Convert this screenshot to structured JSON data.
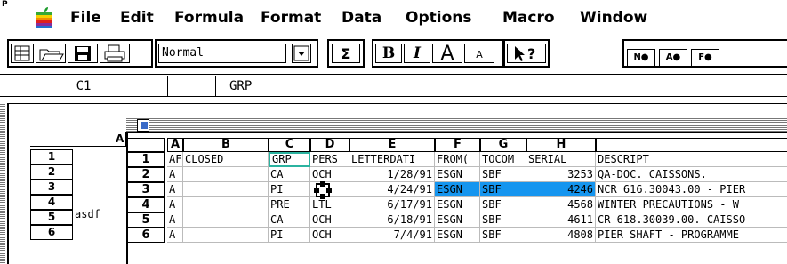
{
  "menubar": {
    "corner_mark": "P",
    "items": [
      "File",
      "Edit",
      "Formula",
      "Format",
      "Data",
      "Options",
      "Macro",
      "Window"
    ]
  },
  "toolbar": {
    "style_value": "Normal",
    "sum_label": "Σ",
    "bold_label": "B",
    "italic_label": "I",
    "grow_label": "A",
    "shrink_label": "A",
    "format_buttons": [
      "N●",
      "A●",
      "F●"
    ]
  },
  "formula_bar": {
    "cell_ref": "C1",
    "value": "GRP"
  },
  "back_sheet": {
    "col_header": "A",
    "row_numbers": [
      "1",
      "2",
      "3",
      "4",
      "5",
      "6"
    ],
    "cell_value": "asdf"
  },
  "front_sheet": {
    "columns": [
      "A",
      "B",
      "C",
      "D",
      "E",
      "F",
      "G",
      "H",
      ""
    ],
    "row_numbers": [
      "1",
      "2",
      "3",
      "4",
      "5",
      "6"
    ],
    "rows": [
      [
        "AF",
        "CLOSED",
        "GRP",
        "PERS",
        "LETTERDATI",
        "FROM(",
        "TOCOM",
        "SERIAL",
        "DESCRIPT"
      ],
      [
        "A",
        "",
        "CA",
        "OCH",
        "1/28/91",
        "ESGN",
        "SBF",
        "3253",
        "QA-DOC. CAISSONS."
      ],
      [
        "A",
        "",
        "PI",
        "",
        "4/24/91",
        "ESGN",
        "SBF",
        "4246",
        "NCR 616.30043.00 - PIER"
      ],
      [
        "A",
        "",
        "PRE",
        "LTL",
        "6/17/91",
        "ESGN",
        "SBF",
        "4568",
        "WINTER PRECAUTIONS - W"
      ],
      [
        "A",
        "",
        "CA",
        "OCH",
        "6/18/91",
        "ESGN",
        "SBF",
        "4611",
        "CR 618.30039.00. CAISSO"
      ],
      [
        "A",
        "",
        "PI",
        "OCH",
        "7/4/91",
        "ESGN",
        "SBF",
        "4808",
        "PIER SHAFT - PROGRAMME"
      ]
    ]
  }
}
